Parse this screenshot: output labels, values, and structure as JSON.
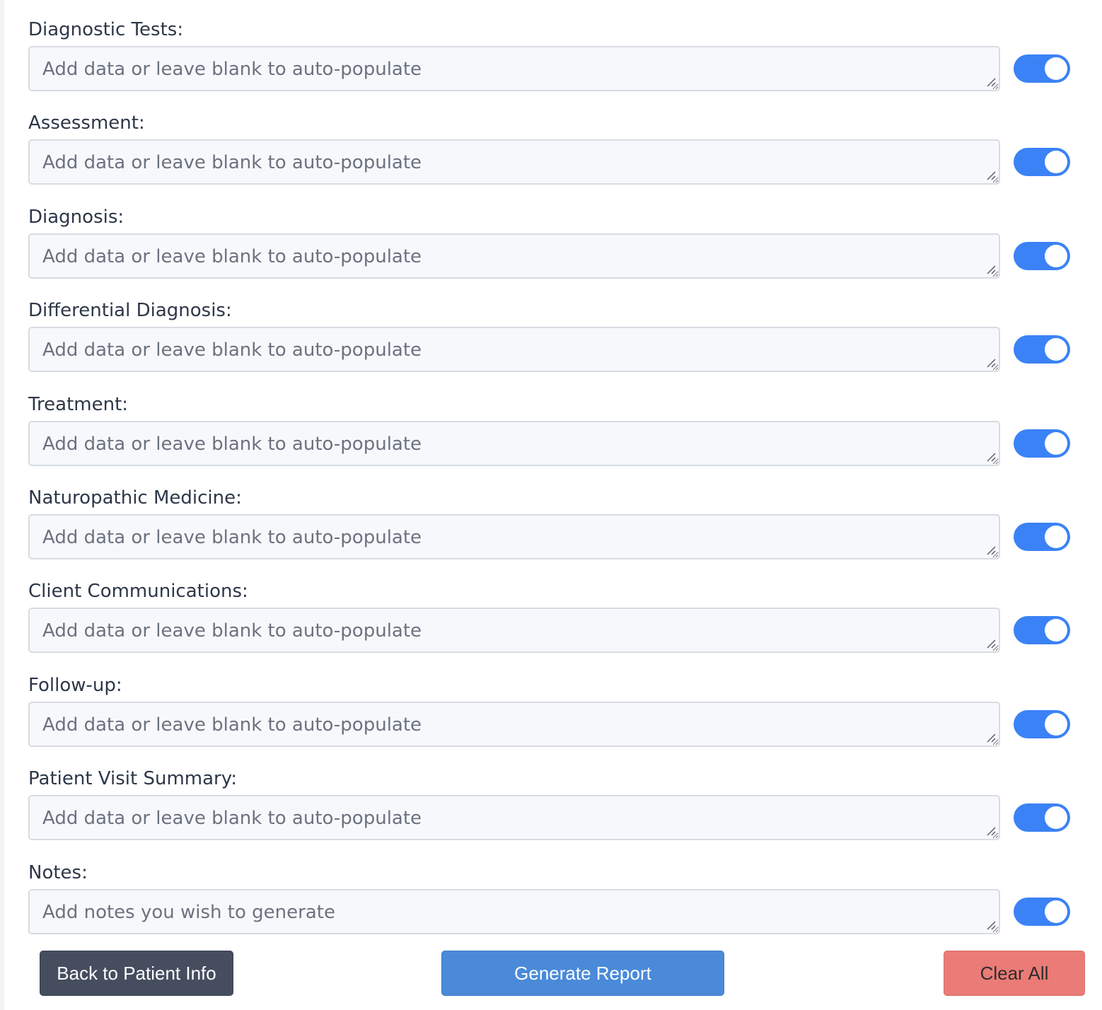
{
  "fields": [
    {
      "label": "Diagnostic Tests:",
      "value": "",
      "placeholder": "Add data or leave blank to auto-populate",
      "enabled": true
    },
    {
      "label": "Assessment:",
      "value": "",
      "placeholder": "Add data or leave blank to auto-populate",
      "enabled": true
    },
    {
      "label": "Diagnosis:",
      "value": "",
      "placeholder": "Add data or leave blank to auto-populate",
      "enabled": true
    },
    {
      "label": "Differential Diagnosis:",
      "value": "",
      "placeholder": "Add data or leave blank to auto-populate",
      "enabled": true
    },
    {
      "label": "Treatment:",
      "value": "",
      "placeholder": "Add data or leave blank to auto-populate",
      "enabled": true
    },
    {
      "label": "Naturopathic Medicine:",
      "value": "",
      "placeholder": "Add data or leave blank to auto-populate",
      "enabled": true
    },
    {
      "label": "Client Communications:",
      "value": "",
      "placeholder": "Add data or leave blank to auto-populate",
      "enabled": true
    },
    {
      "label": "Follow-up:",
      "value": "",
      "placeholder": "Add data or leave blank to auto-populate",
      "enabled": true
    },
    {
      "label": "Patient Visit Summary:",
      "value": "",
      "placeholder": "Add data or leave blank to auto-populate",
      "enabled": true
    },
    {
      "label": "Notes:",
      "value": "",
      "placeholder": "Add notes you wish to generate",
      "enabled": true
    }
  ],
  "actions": {
    "back_label": "Back to Patient Info",
    "generate_label": "Generate Report",
    "clear_label": "Clear All"
  },
  "colors": {
    "toggle_on": "#3b82f6",
    "back_button": "#454d5f",
    "generate_button": "#4a8ad9",
    "clear_button": "#eb7b76"
  },
  "icons": {
    "resize_grip": "resize-handle-icon"
  }
}
